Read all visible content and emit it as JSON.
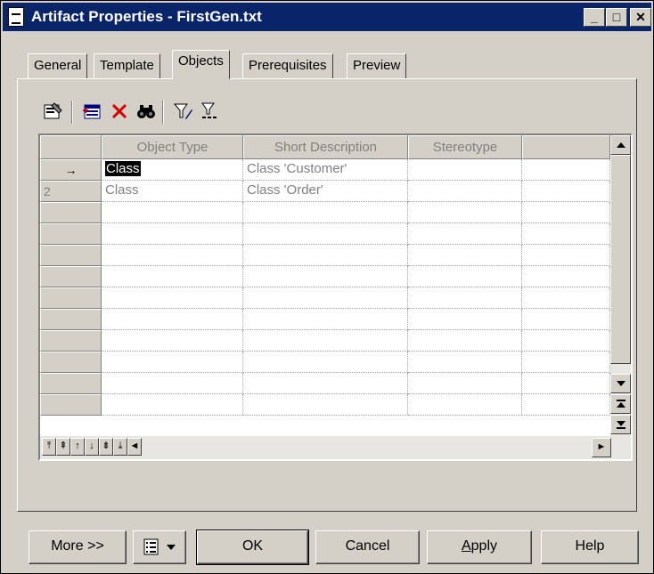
{
  "window": {
    "title": "Artifact Properties - FirstGen.txt",
    "title_icon": "document-icon",
    "controls": {
      "minimize": "_",
      "maximize": "□",
      "close": "✕"
    }
  },
  "tabs": [
    {
      "label": "General"
    },
    {
      "label": "Template"
    },
    {
      "label": "Objects"
    },
    {
      "label": "Prerequisites"
    },
    {
      "label": "Preview"
    }
  ],
  "active_tab": "Objects",
  "toolbar": {
    "tools": [
      "properties-icon",
      "add-objects-icon",
      "delete-icon",
      "find-icon",
      "filter-icon",
      "filter-list-icon"
    ]
  },
  "grid": {
    "columns": [
      "Object Type",
      "Short Description",
      "Stereotype"
    ],
    "rows": [
      {
        "marker": "→",
        "object_type": "Class",
        "short_description": "Class 'Customer'",
        "stereotype": ""
      },
      {
        "marker": "2",
        "object_type": "Class",
        "short_description": "Class 'Order'",
        "stereotype": ""
      }
    ],
    "nav_buttons": [
      "⤒",
      "⇞",
      "↑",
      "↓",
      "⇟",
      "⤓",
      "◄"
    ],
    "hscroll_right": "►"
  },
  "buttons": {
    "more": "More >>",
    "ok": "OK",
    "cancel": "Cancel",
    "apply": "Apply",
    "help": "Help"
  },
  "colors": {
    "titlebar": "#0a246a",
    "face": "#d4d0c8"
  }
}
